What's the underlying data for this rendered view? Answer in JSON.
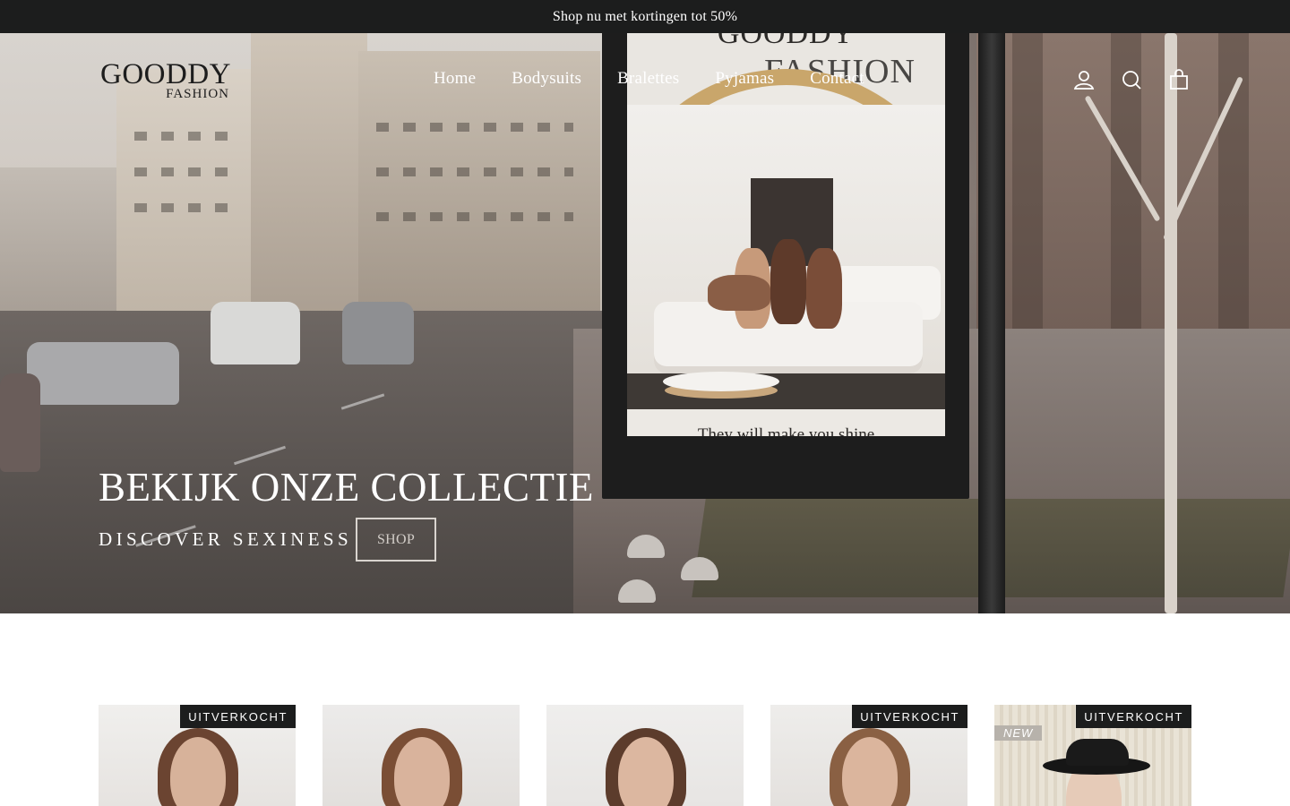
{
  "announcement": {
    "text": "Shop nu met kortingen tot 50%"
  },
  "brand": {
    "name": "GOODDY",
    "sub": "FASHION"
  },
  "nav": {
    "items": [
      {
        "label": "Home"
      },
      {
        "label": "Bodysuits"
      },
      {
        "label": "Bralettes"
      },
      {
        "label": "Pyjamas"
      },
      {
        "label": "Contact"
      }
    ]
  },
  "header_icons": [
    {
      "name": "account-icon"
    },
    {
      "name": "search-icon"
    },
    {
      "name": "cart-icon"
    }
  ],
  "hero": {
    "title": "BEKIJK ONZE COLLECTIE",
    "subtitle": "DISCOVER SEXINESS",
    "button_label": "SHOP",
    "billboard": {
      "logo_main": "GOODDY",
      "logo_sub": "FASHION",
      "tagline": "They will make you shine"
    }
  },
  "products": [
    {
      "badge": "UITVERKOCHT",
      "new": ""
    },
    {
      "badge": "",
      "new": ""
    },
    {
      "badge": "",
      "new": ""
    },
    {
      "badge": "UITVERKOCHT",
      "new": ""
    },
    {
      "badge": "UITVERKOCHT",
      "new": "NEW"
    }
  ],
  "colors": {
    "announcement_bg": "#1c1d1d",
    "badge_bg": "#1c1d1d",
    "text_on_dark": "#ffffff",
    "billboard_arch": "#c9a66b"
  }
}
